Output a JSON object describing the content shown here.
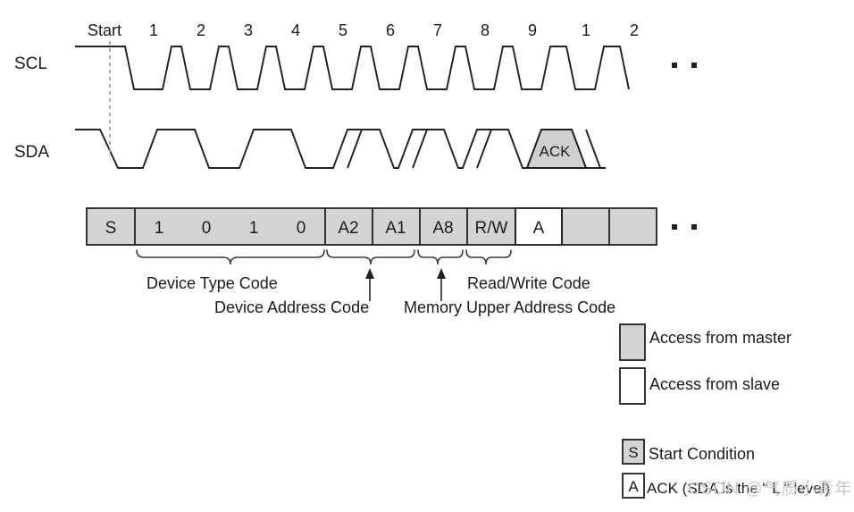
{
  "figure": {
    "type": "i2c-timing-diagram",
    "signals": [
      {
        "name": "SCL",
        "label": "SCL"
      },
      {
        "name": "SDA",
        "label": "SDA"
      }
    ],
    "start_marker_label": "Start",
    "clock_pulse_labels": [
      "1",
      "2",
      "3",
      "4",
      "5",
      "6",
      "7",
      "8",
      "9",
      "1",
      "2"
    ],
    "continuation_dots": "• •",
    "sda_ack_label": "ACK"
  },
  "frame": {
    "cells": [
      {
        "text": "S",
        "fill": "master"
      },
      {
        "text": "1",
        "fill": "master"
      },
      {
        "text": "0",
        "fill": "master"
      },
      {
        "text": "1",
        "fill": "master"
      },
      {
        "text": "0",
        "fill": "master"
      },
      {
        "text": "A2",
        "fill": "master"
      },
      {
        "text": "A1",
        "fill": "master"
      },
      {
        "text": "A8",
        "fill": "master"
      },
      {
        "text": "R/W",
        "fill": "master"
      },
      {
        "text": "A",
        "fill": "slave"
      },
      {
        "text": "",
        "fill": "master"
      },
      {
        "text": "",
        "fill": "master"
      }
    ]
  },
  "annotations": [
    {
      "label": "Device Type Code"
    },
    {
      "label": "Device Address Code"
    },
    {
      "label": "Memory Upper Address Code"
    },
    {
      "label": "Read/Write Code"
    }
  ],
  "legend": {
    "swatches": [
      {
        "label": "Access from master",
        "fill": "master"
      },
      {
        "label": "Access from slave",
        "fill": "slave"
      }
    ],
    "symbols": [
      {
        "box": "S",
        "label": "Start Condition",
        "fill": "master"
      },
      {
        "box": "A",
        "label": "ACK (SDA is the \" L \" level)",
        "fill": "slave"
      }
    ]
  },
  "watermark": {
    "text": "CSDN @气质小青年"
  },
  "colors": {
    "master_fill": "#d4d4d4",
    "slave_fill": "#ffffff",
    "stroke": "#231f20",
    "start_dash": "#9a9a9a",
    "watermark": "#c9c9c9"
  }
}
